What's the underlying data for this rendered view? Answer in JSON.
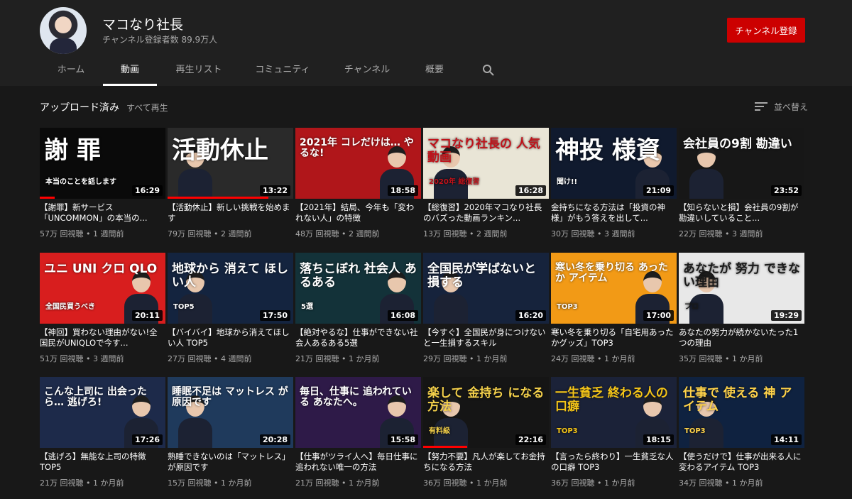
{
  "channel": {
    "name": "マコなり社長",
    "subscribers": "チャンネル登録者数 89.9万人",
    "subscribe_label": "チャンネル登録"
  },
  "tabs": [
    "ホーム",
    "動画",
    "再生リスト",
    "コミュニティ",
    "チャンネル",
    "概要"
  ],
  "active_tab": "動画",
  "shelf": {
    "title": "アップロード済み",
    "play_all": "すべて再生",
    "sort_label": "並べ替え"
  },
  "colors": {
    "accent": "#cc0000",
    "background": "#181818",
    "header": "#202020",
    "secondary_text": "#aaaaaa"
  },
  "videos": [
    {
      "thumb_text": "謝 罪",
      "thumb_sub": "本当のことを話します",
      "duration": "16:29",
      "progress": 0.12,
      "title": "【謝罪】新サービス「UNCOMMON」の本当の...",
      "views": "57万 回視聴",
      "age": "1 週間前",
      "bg": "#0a0a0a",
      "fg": "#ffffff",
      "person": false
    },
    {
      "thumb_text": "活動休止",
      "thumb_sub": "",
      "duration": "13:22",
      "progress": 0.8,
      "title": "【活動休止】新しい挑戦を始めます",
      "views": "79万 回視聴",
      "age": "2 週間前",
      "bg": "#2a2a2a",
      "fg": "#ffffff",
      "person": true
    },
    {
      "thumb_text": "2021年 コレだけは… やるな!",
      "thumb_sub": "",
      "duration": "18:58",
      "progress": 0,
      "title": "【2021年】結局、今年も「変われない人」の特徴",
      "views": "48万 回視聴",
      "age": "2 週間前",
      "bg": "#b0161a",
      "fg": "#ffffff",
      "person": true
    },
    {
      "thumb_text": "マコなり社長の 人気動画",
      "thumb_sub": "2020年 総復習",
      "duration": "16:28",
      "progress": 0,
      "title": "【総復習】2020年マコなり社長のバズった動画ランキン...",
      "views": "13万 回視聴",
      "age": "2 週間前",
      "bg": "#e9e5d6",
      "fg": "#c0121a",
      "person": true
    },
    {
      "thumb_text": "神投 様資",
      "thumb_sub": "聞け!!",
      "duration": "21:09",
      "progress": 0,
      "title": "金持ちになる方法は「投資の神様」がもう答えを出して...",
      "views": "30万 回視聴",
      "age": "3 週間前",
      "bg": "#101a2e",
      "fg": "#ffffff",
      "person": true
    },
    {
      "thumb_text": "会社員の9割 勘違い",
      "thumb_sub": "",
      "duration": "23:52",
      "progress": 0,
      "title": "【知らないと損】会社員の9割が勘違いしていること...",
      "views": "22万 回視聴",
      "age": "3 週間前",
      "bg": "#171717",
      "fg": "#ffffff",
      "person": true
    },
    {
      "thumb_text": "ユニ UNI クロ QLO",
      "thumb_sub": "全国民買うべき",
      "duration": "20:11",
      "progress": 0,
      "title": "【神回】買わない理由がない!全国民がUNIQLOで今す...",
      "views": "51万 回視聴",
      "age": "3 週間前",
      "bg": "#d81e1e",
      "fg": "#ffffff",
      "person": true
    },
    {
      "thumb_text": "地球から 消えて ほしい人",
      "thumb_sub": "TOP5",
      "duration": "17:50",
      "progress": 0,
      "title": "【バイバイ】地球から消えてほしい人 TOP5",
      "views": "27万 回視聴",
      "age": "4 週間前",
      "bg": "#14243f",
      "fg": "#ffffff",
      "person": true
    },
    {
      "thumb_text": "落ちこぼれ 社会人 あるある",
      "thumb_sub": "5選",
      "duration": "16:08",
      "progress": 0,
      "title": "【絶対やるな】仕事ができない社会人あるある5選",
      "views": "21万 回視聴",
      "age": "1 か月前",
      "bg": "#133239",
      "fg": "#ffffff",
      "person": true
    },
    {
      "thumb_text": "全国民が学ばないと 損する",
      "thumb_sub": "",
      "duration": "16:20",
      "progress": 0,
      "title": "【今すぐ】全国民が身につけないと一生損するスキル",
      "views": "29万 回視聴",
      "age": "1 か月前",
      "bg": "#16233c",
      "fg": "#ffffff",
      "person": true
    },
    {
      "thumb_text": "寒い冬を乗り切る あったか アイテム",
      "thumb_sub": "TOP3",
      "duration": "17:00",
      "progress": 0,
      "title": "寒い冬を乗り切る「自宅用あったかグッズ」TOP3",
      "views": "24万 回視聴",
      "age": "1 か月前",
      "bg": "#f29a16",
      "fg": "#ffffff",
      "person": true
    },
    {
      "thumb_text": "あなたが 努力 できない理由",
      "thumb_sub": "プロ",
      "duration": "19:29",
      "progress": 0,
      "title": "あなたの努力が続かないたった1つの理由",
      "views": "35万 回視聴",
      "age": "1 か月前",
      "bg": "#e8e8e8",
      "fg": "#1a1a1a",
      "person": true
    },
    {
      "thumb_text": "こんな上司に 出会ったら… 逃げろ!",
      "thumb_sub": "",
      "duration": "17:26",
      "progress": 0,
      "title": "【逃げろ】無能な上司の特徴TOP5",
      "views": "21万 回視聴",
      "age": "1 か月前",
      "bg": "#1d2a4a",
      "fg": "#ffffff",
      "person": true
    },
    {
      "thumb_text": "睡眠不足は マットレス が原因です",
      "thumb_sub": "",
      "duration": "20:28",
      "progress": 0,
      "title": "熟睡できないのは「マットレス」が原因です",
      "views": "15万 回視聴",
      "age": "1 か月前",
      "bg": "#1f3a5c",
      "fg": "#ffffff",
      "person": true
    },
    {
      "thumb_text": "毎日、仕事に 追われている あなたへ。",
      "thumb_sub": "",
      "duration": "15:58",
      "progress": 0,
      "title": "【仕事がツライ人へ】毎日仕事に追われない唯一の方法",
      "views": "21万 回視聴",
      "age": "1 か月前",
      "bg": "#2e1a48",
      "fg": "#ffffff",
      "person": true
    },
    {
      "thumb_text": "楽して 金持ち になる方法",
      "thumb_sub": "有料級",
      "duration": "22:16",
      "progress": 0.35,
      "title": "【努力不要】凡人が楽してお金持ちになる方法",
      "views": "36万 回視聴",
      "age": "1 か月前",
      "bg": "#151515",
      "fg": "#f5d14b",
      "person": true
    },
    {
      "thumb_text": "一生貧乏 終わる人の 口癖",
      "thumb_sub": "TOP3",
      "duration": "18:15",
      "progress": 0,
      "title": "【言ったら終わり】一生貧乏な人の口癖 TOP3",
      "views": "36万 回視聴",
      "age": "1 か月前",
      "bg": "#1b2238",
      "fg": "#f5c518",
      "person": true
    },
    {
      "thumb_text": "仕事で 使える 神 アイテム",
      "thumb_sub": "TOP3",
      "duration": "14:11",
      "progress": 0,
      "title": "【使うだけで】仕事が出来る人に変わるアイテム TOP3",
      "views": "34万 回視聴",
      "age": "1 か月前",
      "bg": "#0f2240",
      "fg": "#ffd34a",
      "person": true
    }
  ]
}
